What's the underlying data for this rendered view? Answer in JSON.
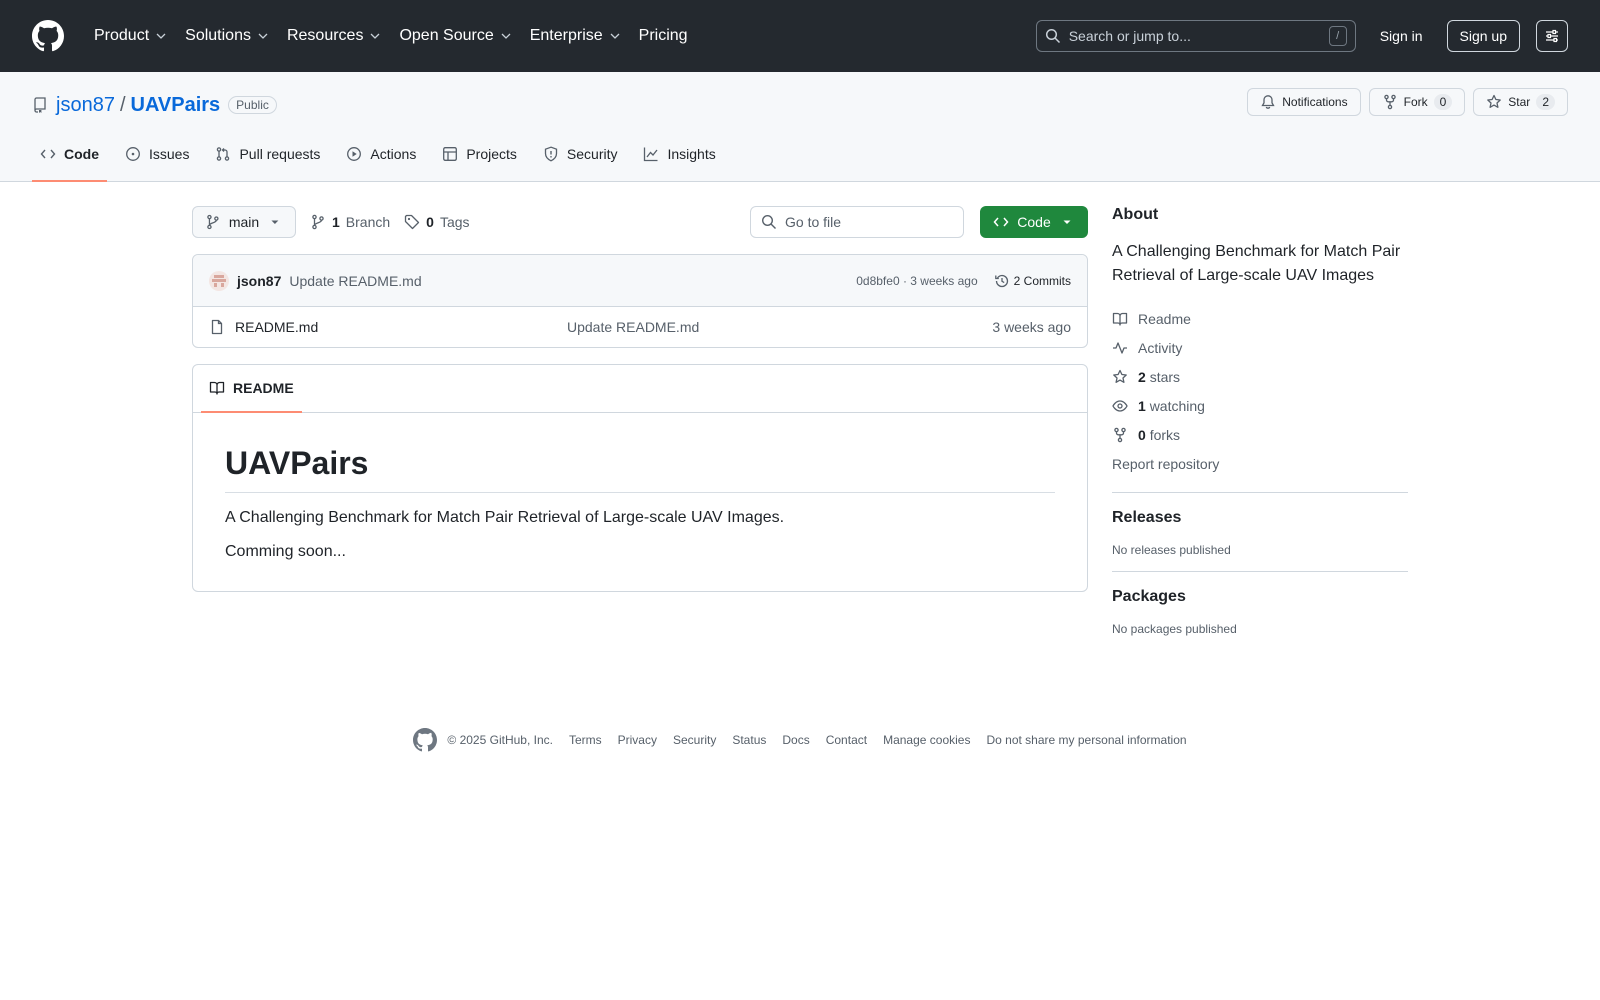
{
  "topnav": {
    "items": [
      {
        "label": "Product"
      },
      {
        "label": "Solutions"
      },
      {
        "label": "Resources"
      },
      {
        "label": "Open Source"
      },
      {
        "label": "Enterprise"
      },
      {
        "label": "Pricing"
      }
    ],
    "search_placeholder": "Search or jump to...",
    "search_shortcut": "/",
    "signin": "Sign in",
    "signup": "Sign up"
  },
  "repo": {
    "owner": "json87",
    "separator": "/",
    "name": "UAVPairs",
    "visibility": "Public",
    "notifications": "Notifications",
    "fork_label": "Fork",
    "fork_count": "0",
    "star_label": "Star",
    "star_count": "2"
  },
  "tabs": [
    {
      "label": "Code",
      "icon": "code-icon",
      "active": true
    },
    {
      "label": "Issues",
      "icon": "issue-icon"
    },
    {
      "label": "Pull requests",
      "icon": "pull-request-icon"
    },
    {
      "label": "Actions",
      "icon": "play-icon"
    },
    {
      "label": "Projects",
      "icon": "table-icon"
    },
    {
      "label": "Security",
      "icon": "shield-icon"
    },
    {
      "label": "Insights",
      "icon": "graph-icon"
    }
  ],
  "filebar": {
    "branch": "main",
    "branch_count": "1",
    "branch_label": "Branch",
    "tag_count": "0",
    "tag_label": "Tags",
    "goto_placeholder": "Go to file",
    "code_button": "Code"
  },
  "commit": {
    "author": "json87",
    "message": "Update README.md",
    "meta": "0d8bfe0 · 3 weeks ago",
    "commits": "2 Commits"
  },
  "files": [
    {
      "name": "README.md",
      "message": "Update README.md",
      "time": "3 weeks ago"
    }
  ],
  "readme": {
    "tab": "README",
    "title": "UAVPairs",
    "paragraphs": [
      "A Challenging Benchmark for Match Pair Retrieval of Large-scale UAV Images.",
      "Comming soon..."
    ]
  },
  "about": {
    "heading": "About",
    "description": "A Challenging Benchmark for Match Pair Retrieval of Large-scale UAV Images",
    "readme": "Readme",
    "activity": "Activity",
    "stars_count": "2",
    "stars_label": "stars",
    "watching_count": "1",
    "watching_label": "watching",
    "forks_count": "0",
    "forks_label": "forks",
    "report": "Report repository"
  },
  "releases": {
    "heading": "Releases",
    "empty": "No releases published"
  },
  "packages": {
    "heading": "Packages",
    "empty": "No packages published"
  },
  "footer": {
    "copyright": "© 2025 GitHub, Inc.",
    "links": [
      "Terms",
      "Privacy",
      "Security",
      "Status",
      "Docs",
      "Contact",
      "Manage cookies",
      "Do not share my personal information"
    ]
  },
  "colors": {
    "header_bg": "#24292f",
    "link": "#0969da",
    "primary_button": "#1f883d",
    "active_tab_underline": "#fd8c73"
  }
}
